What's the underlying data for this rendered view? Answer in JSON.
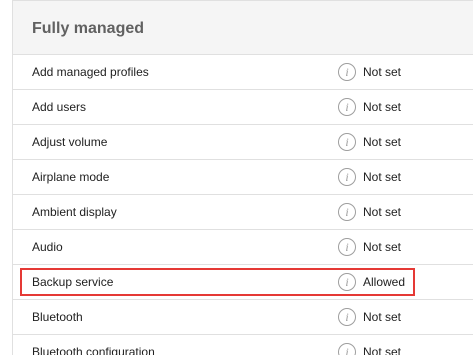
{
  "section": {
    "title": "Fully managed"
  },
  "colors": {
    "highlight": "#e53935",
    "header_bg": "#f5f5f5",
    "divider": "#e0e0e0"
  },
  "rows": [
    {
      "label": "Add managed profiles",
      "value": "Not set",
      "icon": "info-icon"
    },
    {
      "label": "Add users",
      "value": "Not set",
      "icon": "info-icon"
    },
    {
      "label": "Adjust volume",
      "value": "Not set",
      "icon": "info-icon"
    },
    {
      "label": "Airplane mode",
      "value": "Not set",
      "icon": "info-icon"
    },
    {
      "label": "Ambient display",
      "value": "Not set",
      "icon": "info-icon"
    },
    {
      "label": "Audio",
      "value": "Not set",
      "icon": "info-icon"
    },
    {
      "label": "Backup service",
      "value": "Allowed",
      "icon": "info-icon",
      "highlighted": true
    },
    {
      "label": "Bluetooth",
      "value": "Not set",
      "icon": "info-icon"
    },
    {
      "label": "Bluetooth configuration",
      "value": "Not set",
      "icon": "info-icon"
    }
  ]
}
